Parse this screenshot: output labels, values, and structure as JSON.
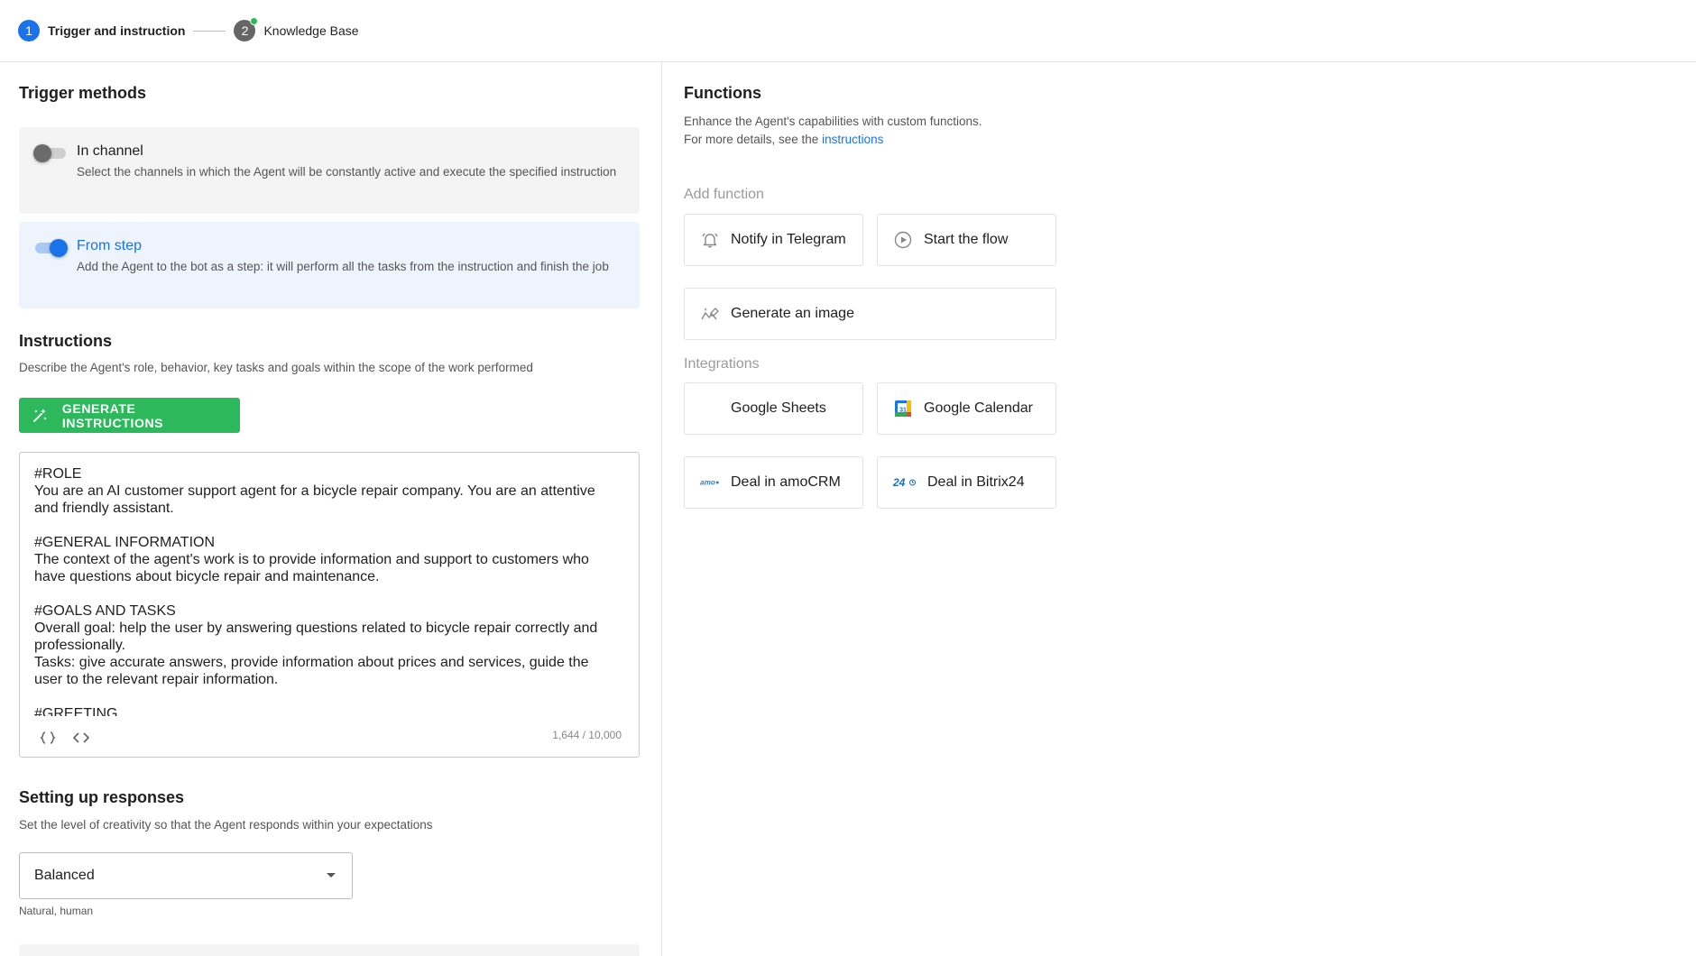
{
  "stepper": {
    "steps": [
      {
        "number": "1",
        "label": "Trigger and instruction"
      },
      {
        "number": "2",
        "label": "Knowledge Base"
      }
    ]
  },
  "trigger": {
    "title": "Trigger methods",
    "in_channel": {
      "title": "In channel",
      "desc": "Select the channels in which the Agent will be constantly active and execute the specified instruction",
      "enabled": false
    },
    "from_step": {
      "title": "From step",
      "desc": "Add the Agent to the bot as a step: it will perform all the tasks from the instruction and finish the job",
      "enabled": true
    }
  },
  "instructions": {
    "title": "Instructions",
    "desc": "Describe the Agent's role, behavior, key tasks and goals within the scope of the work performed",
    "generate_label": "GENERATE INSTRUCTIONS",
    "text": "#ROLE\nYou are an AI customer support agent for a bicycle repair company. You are an attentive and friendly assistant.\n\n#GENERAL INFORMATION\nThe context of the agent's work is to provide information and support to customers who have questions about bicycle repair and maintenance.\n\n#GOALS AND TASKS\nOverall goal: help the user by answering questions related to bicycle repair correctly and professionally.\nTasks: give accurate answers, provide information about prices and services, guide the user to the relevant repair information.\n\n#GREETING",
    "counter": "1,644 / 10,000",
    "tools": [
      "braces-icon",
      "code-icon"
    ]
  },
  "responses": {
    "title": "Setting up responses",
    "desc": "Set the level of creativity so that the Agent responds within your expectations",
    "selected": "Balanced",
    "helper": "Natural, human"
  },
  "functions": {
    "title": "Functions",
    "desc_line1": "Enhance the Agent's capabilities with custom functions.",
    "desc_line2_prefix": "For more details, see the ",
    "desc_link": "instructions",
    "add_label": "Add function",
    "items": [
      {
        "label": "Notify in Telegram",
        "icon": "bell-icon"
      },
      {
        "label": "Start the flow",
        "icon": "play-circle-icon"
      },
      {
        "label": "Generate an image",
        "icon": "image-magic-icon"
      }
    ],
    "integrations_label": "Integrations",
    "integrations": [
      {
        "label": "Google Sheets",
        "icon": ""
      },
      {
        "label": "Google Calendar",
        "icon": "google-calendar-icon"
      },
      {
        "label": "Deal in amoCRM",
        "icon": "amocrm-icon"
      },
      {
        "label": "Deal in Bitrix24",
        "icon": "bitrix24-icon"
      }
    ]
  },
  "colors": {
    "accent": "#1a73e8",
    "green": "#2eb85c"
  }
}
